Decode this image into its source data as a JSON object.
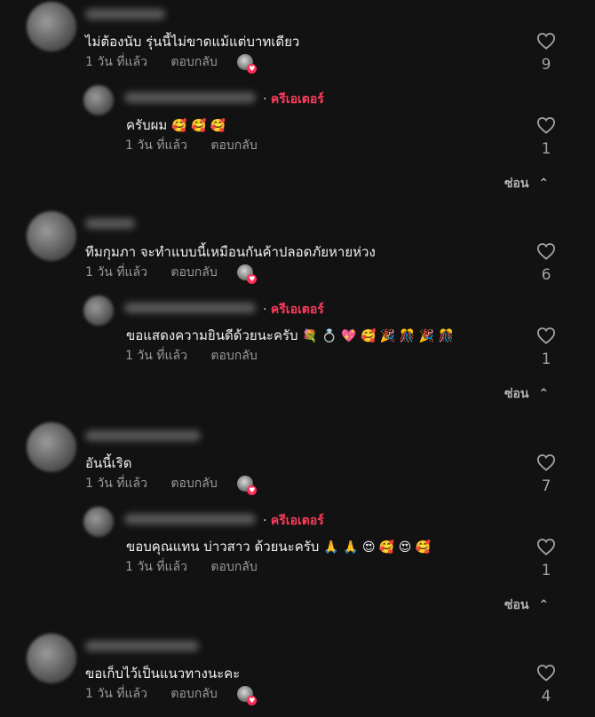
{
  "threads": [
    {
      "comment": {
        "text": "ไม่ต้องนับ รุ่นนี้ไม่ขาดแม้แต่บาทเดียว",
        "time": "1 วัน ที่แล้ว",
        "reply": "ตอบกลับ",
        "likes": "9"
      },
      "creator_reply": {
        "tag_sep": "·",
        "tag": "ครีเอเตอร์",
        "text": "ครับผม",
        "emojis": "🥰 🥰 🥰",
        "time": "1 วัน ที่แล้ว",
        "reply": "ตอบกลับ",
        "likes": "1"
      },
      "hide": "ซ่อน"
    },
    {
      "comment": {
        "text": "ทีมกุมภา จะทำแบบนี้เหมือนกันค้าปลอดภัยหายห่วง",
        "time": "1 วัน ที่แล้ว",
        "reply": "ตอบกลับ",
        "likes": "6"
      },
      "creator_reply": {
        "tag_sep": "·",
        "tag": "ครีเอเตอร์",
        "text": "ขอแสดงความยินดีด้วยนะครับ",
        "emojis": "💐 💍 💖 🥰 🎉 🎊 🎉 🎊",
        "time": "1 วัน ที่แล้ว",
        "reply": "ตอบกลับ",
        "likes": "1"
      },
      "hide": "ซ่อน"
    },
    {
      "comment": {
        "text": "อันนี้เริด",
        "time": "1 วัน ที่แล้ว",
        "reply": "ตอบกลับ",
        "likes": "7"
      },
      "creator_reply": {
        "tag_sep": "·",
        "tag": "ครีเอเตอร์",
        "text": "ขอบคุณแทน บ่าวสาว ด้วยนะครับ",
        "emojis": "🙏 🙏 😍 🥰 😍 🥰",
        "time": "1 วัน ที่แล้ว",
        "reply": "ตอบกลับ",
        "likes": "1"
      },
      "hide": "ซ่อน"
    },
    {
      "comment": {
        "text": "ขอเก็บไว้เป็นแนวทางนะคะ",
        "time": "1 วัน ที่แล้ว",
        "reply": "ตอบกลับ",
        "likes": "4"
      }
    }
  ]
}
